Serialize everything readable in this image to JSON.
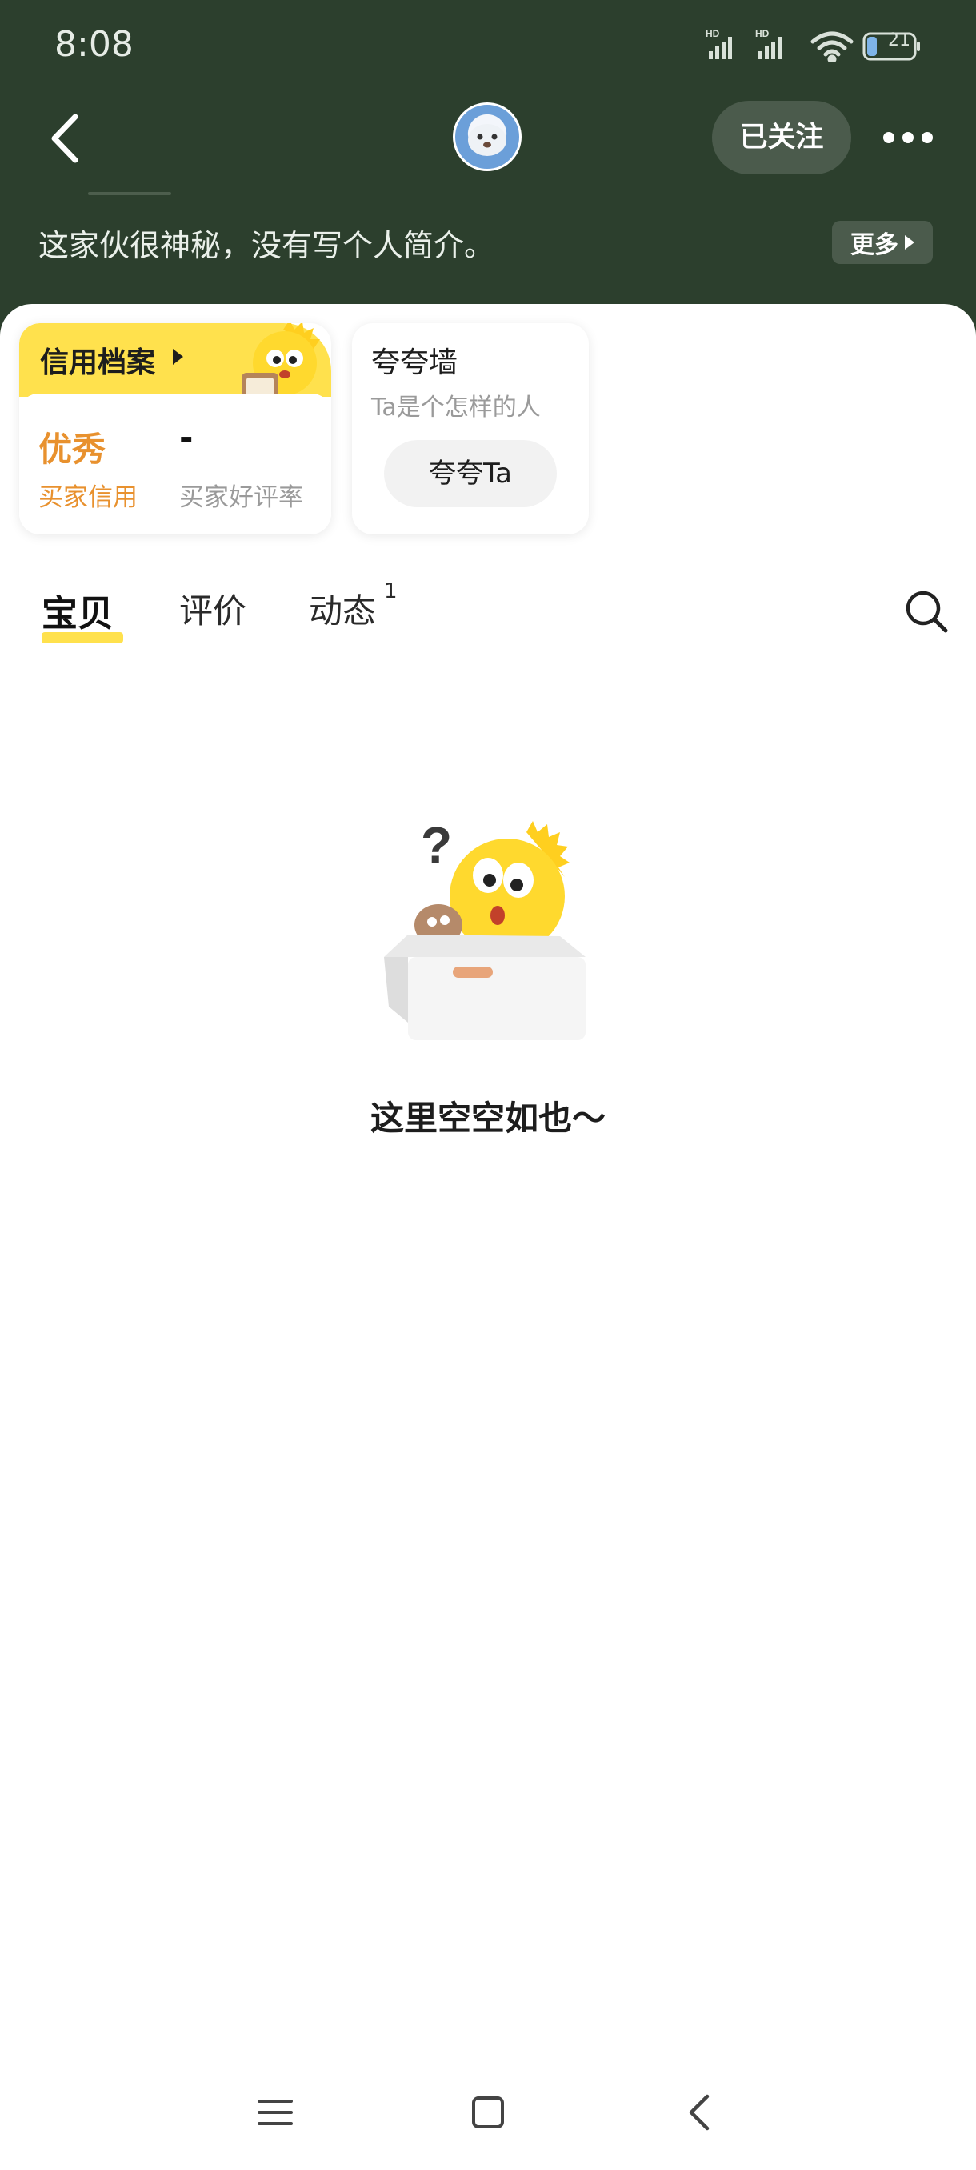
{
  "status_bar": {
    "time": "8:08",
    "battery": "21",
    "icons": [
      "hd-signal-icon",
      "hd-signal-icon",
      "wifi-icon",
      "battery-icon"
    ]
  },
  "header": {
    "follow_label": "已关注",
    "bio": "这家伙很神秘，没有写个人简介。",
    "more_label": "更多"
  },
  "credit_card": {
    "title": "信用档案",
    "rating_value": "优秀",
    "rating_label": "买家信用",
    "positive_rate_value": "-",
    "positive_rate_label": "买家好评率"
  },
  "praise_card": {
    "title": "夸夸墙",
    "subtitle": "Ta是个怎样的人",
    "button_label": "夸夸Ta"
  },
  "tabs": [
    {
      "label": "宝贝",
      "active": true
    },
    {
      "label": "评价",
      "active": false
    },
    {
      "label": "动态",
      "active": false,
      "badge": "1"
    }
  ],
  "empty_state": {
    "message": "这里空空如也～"
  },
  "colors": {
    "header_bg": "#2c3f2d",
    "accent_yellow": "#ffe14d",
    "credit_orange": "#e8912e"
  }
}
